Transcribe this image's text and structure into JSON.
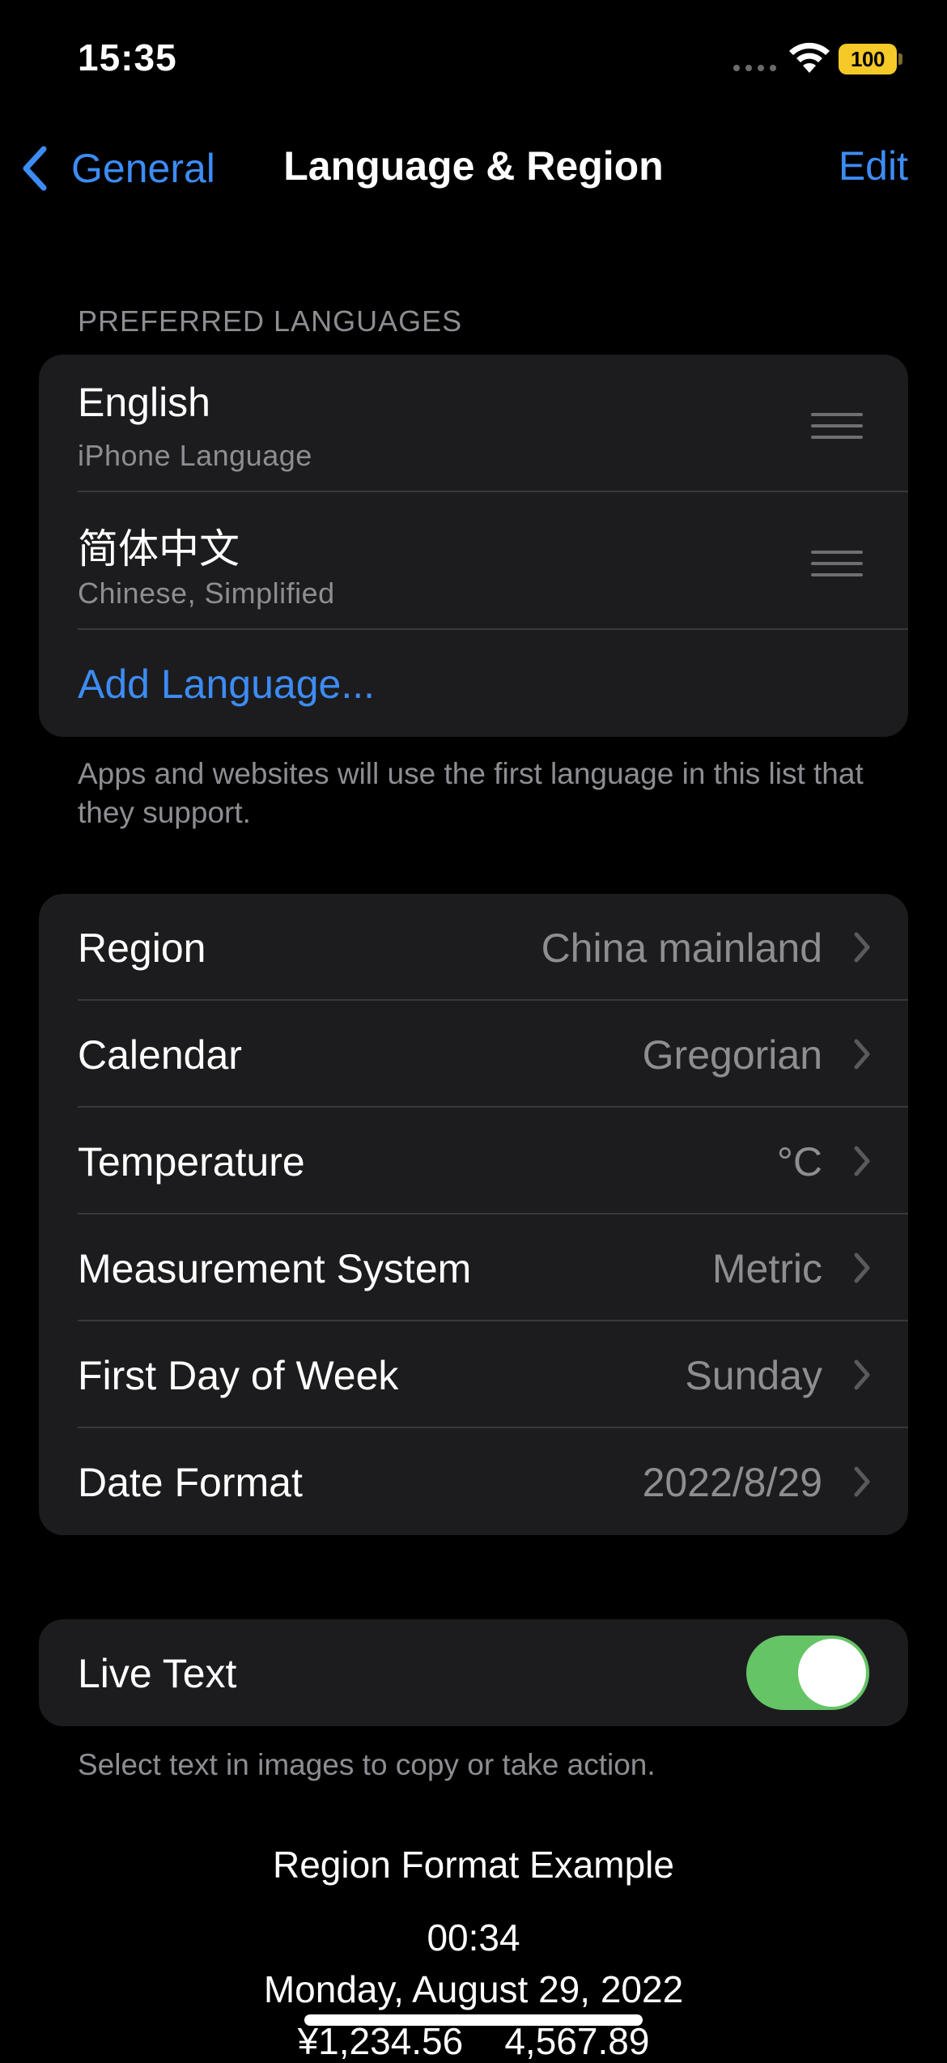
{
  "status_bar": {
    "time": "15:35",
    "battery": "100"
  },
  "nav": {
    "back_label": "General",
    "title": "Language & Region",
    "edit_label": "Edit"
  },
  "languages_section": {
    "header": "PREFERRED LANGUAGES",
    "items": [
      {
        "name": "English",
        "subtitle": "iPhone Language"
      },
      {
        "name": "简体中文",
        "subtitle": "Chinese, Simplified"
      }
    ],
    "add_label": "Add Language...",
    "footer": "Apps and websites will use the first language in this list that they support."
  },
  "region_settings": [
    {
      "label": "Region",
      "value": "China mainland"
    },
    {
      "label": "Calendar",
      "value": "Gregorian"
    },
    {
      "label": "Temperature",
      "value": "°C"
    },
    {
      "label": "Measurement System",
      "value": "Metric"
    },
    {
      "label": "First Day of Week",
      "value": "Sunday"
    },
    {
      "label": "Date Format",
      "value": "2022/8/29"
    }
  ],
  "live_text": {
    "label": "Live Text",
    "enabled": true,
    "footer": "Select text in images to copy or take action."
  },
  "region_example": {
    "title": "Region Format Example",
    "time": "00:34",
    "date": "Monday, August 29, 2022",
    "numbers": "¥1,234.56    4,567.89"
  },
  "colors": {
    "accent": "#3d8cf5",
    "toggle_on": "#65c466",
    "cell_bg": "#1c1c1e",
    "secondary_text": "#8d8d92"
  }
}
